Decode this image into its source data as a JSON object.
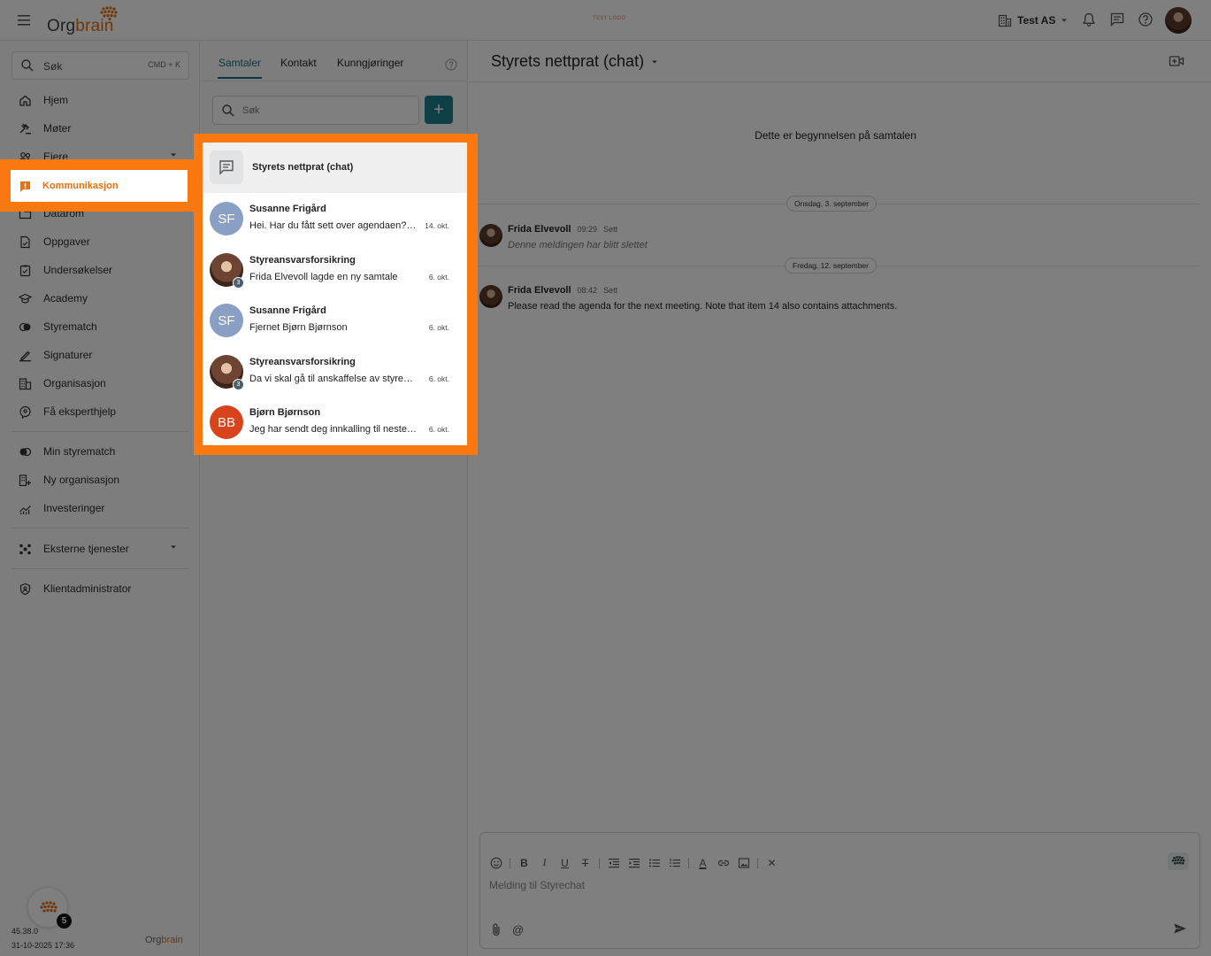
{
  "topbar": {
    "logo_text_a": "Org",
    "logo_text_b": "brain",
    "test_logo": "TEST LOGO",
    "org_name": "Test AS"
  },
  "sidebar": {
    "search_label": "Søk",
    "search_shortcut": "CMD + K",
    "items": [
      {
        "label": "Hjem",
        "icon": "home-icon"
      },
      {
        "label": "Møter",
        "icon": "gavel-icon"
      },
      {
        "label": "Eiere",
        "icon": "people-icon"
      },
      {
        "label": "Kommunikasjon",
        "icon": "announcement-icon"
      },
      {
        "label": "Datarom",
        "icon": "folder-icon"
      },
      {
        "label": "Oppgaver",
        "icon": "task-icon"
      },
      {
        "label": "Undersøkelser",
        "icon": "survey-icon"
      },
      {
        "label": "Academy",
        "icon": "graduation-cap-icon"
      },
      {
        "label": "Styrematch",
        "icon": "match-icon"
      },
      {
        "label": "Signaturer",
        "icon": "signature-pen-icon"
      },
      {
        "label": "Organisasjon",
        "icon": "building-icon"
      },
      {
        "label": "Få eksperthjelp",
        "icon": "expert-help-icon"
      }
    ],
    "items2": [
      {
        "label": "Min styrematch",
        "icon": "match-toggle-icon"
      },
      {
        "label": "Ny organisasjon",
        "icon": "building-add-icon"
      },
      {
        "label": "Investeringer",
        "icon": "chart-icon"
      }
    ],
    "external": "Eksterne tjenester",
    "client_admin": "Klientadministrator",
    "version": "45.38.0",
    "build_date": "31-10-2025 17:36",
    "help_badge": "5",
    "footer_logo_a": "Org",
    "footer_logo_b": "brain"
  },
  "conversations": {
    "tabs": [
      "Samtaler",
      "Kontakt",
      "Kunngjøringer"
    ],
    "search_placeholder": "Søk",
    "new_button": "+",
    "group_name": "Styrets nettprat (chat)",
    "items": [
      {
        "name": "Susanne Frigård",
        "preview": "Hei. Har du fått sett over agendaen? Det er viktig at du er klar over...",
        "date": "14. okt.",
        "initials": "SF",
        "avatar_color": "#8a9fc4",
        "photo": false,
        "count": ""
      },
      {
        "name": "Styreansvarsforsikring",
        "preview": "Frida Elvevoll lagde en ny samtale",
        "date": "6. okt.",
        "initials": "",
        "avatar_color": "",
        "photo": true,
        "count": "3"
      },
      {
        "name": "Susanne Frigård",
        "preview": "Fjernet Bjørn Bjørnson",
        "date": "6. okt.",
        "initials": "SF",
        "avatar_color": "#8a9fc4",
        "photo": false,
        "count": ""
      },
      {
        "name": "Styreansvarsforsikring",
        "preview": "Da vi skal gå til anskaffelse av styreansvarsforsikring trenger vi...",
        "date": "6. okt.",
        "initials": "",
        "avatar_color": "",
        "photo": true,
        "count": "3"
      },
      {
        "name": "Bjørn Bjørnson",
        "preview": "Jeg har sendt deg innkalling til neste styremøte",
        "date": "6. okt.",
        "initials": "BB",
        "avatar_color": "#d8431b",
        "photo": false,
        "count": ""
      }
    ]
  },
  "chat": {
    "title": "Styrets nettprat (chat)",
    "begin_text": "Dette er begynnelsen på samtalen",
    "date1": "Onsdag, 3. september",
    "date2": "Fredag, 12. september",
    "messages": [
      {
        "name": "Frida Elvevoll",
        "time": "09:29",
        "seen": "Sett",
        "body": "Denne meldingen har blitt slettet"
      },
      {
        "name": "Frida Elvevoll",
        "time": "08:42",
        "seen": "Sett",
        "body": "Please read the agenda for the next meeting. Note that item 14 also contains attachments."
      }
    ],
    "composer_placeholder": "Melding til Styrechat",
    "toolbar": {
      "bold": "B",
      "italic": "I",
      "underline": "U",
      "strike": "T",
      "text_color": "A",
      "clear": "✕",
      "mention": "@"
    }
  },
  "colors": {
    "accent": "#1e7e8c",
    "highlight": "#f9780f",
    "brand_orange": "#e46d12"
  }
}
